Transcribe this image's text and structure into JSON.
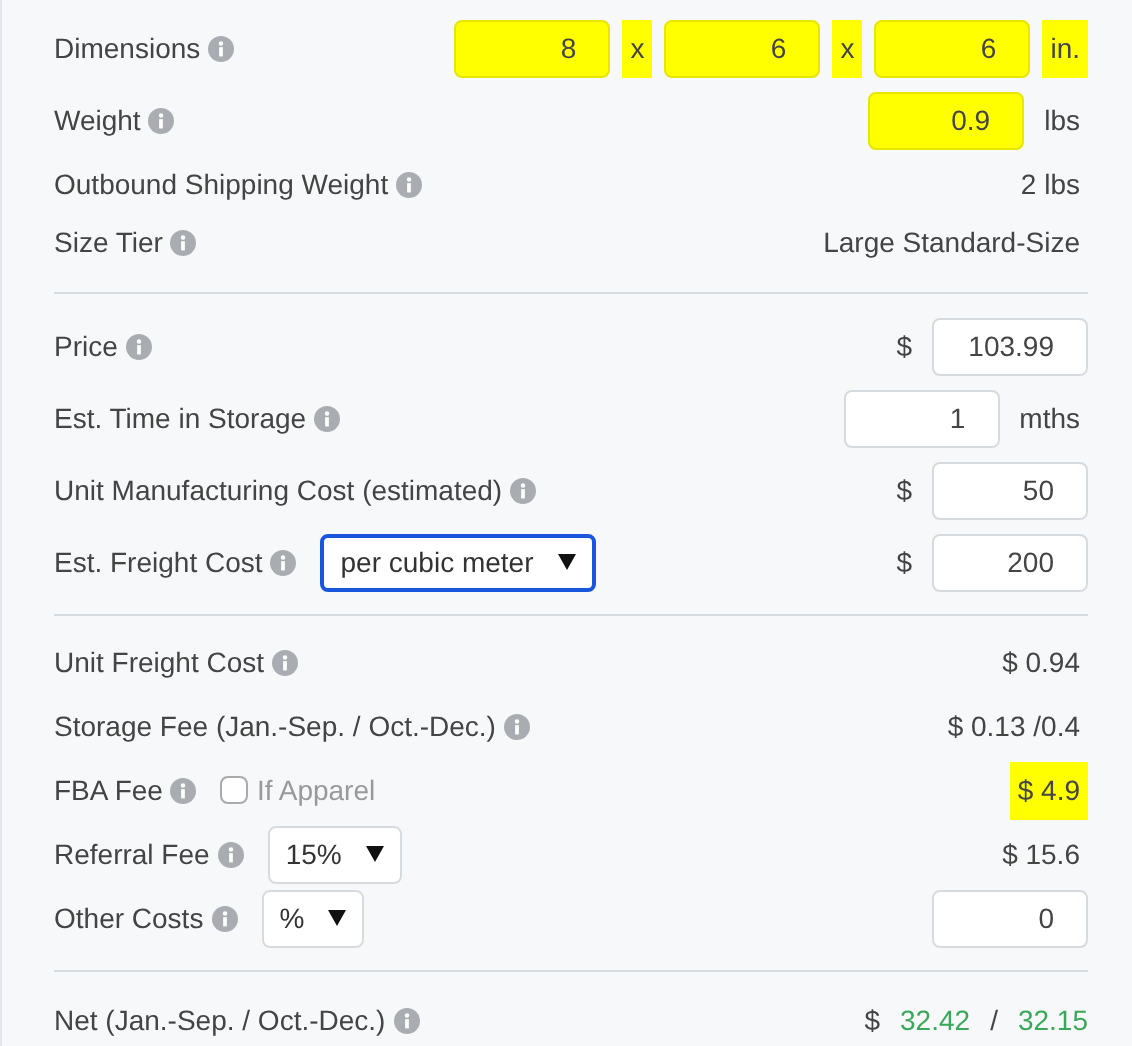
{
  "sections": [
    {
      "rows": [
        {
          "label": "Dimensions",
          "left": [],
          "right": [
            {
              "kind": "input",
              "value": "8",
              "highlighted": true
            },
            {
              "kind": "unit",
              "text": "x",
              "highlighted": true
            },
            {
              "kind": "input",
              "value": "6",
              "highlighted": true
            },
            {
              "kind": "unit",
              "text": "x",
              "highlighted": true
            },
            {
              "kind": "input",
              "value": "6",
              "highlighted": true
            },
            {
              "kind": "unit",
              "text": "in.",
              "highlighted": true
            }
          ]
        },
        {
          "label": "Weight",
          "left": [],
          "right": [
            {
              "kind": "input",
              "value": "0.9",
              "highlighted": true
            },
            {
              "kind": "unit",
              "text": "lbs",
              "highlighted": false
            }
          ]
        },
        {
          "label": "Outbound Shipping Weight",
          "left": [],
          "right": [
            {
              "kind": "unit",
              "text": "2 lbs",
              "highlighted": false
            }
          ]
        },
        {
          "label": "Size Tier",
          "left": [],
          "right": [
            {
              "kind": "unit",
              "text": "Large Standard-Size",
              "highlighted": false
            }
          ]
        }
      ]
    },
    {
      "rows": [
        {
          "label": "Price",
          "left": [],
          "right": [
            {
              "kind": "unit",
              "text": "$",
              "highlighted": false
            },
            {
              "kind": "input",
              "value": "103.99",
              "highlighted": false
            }
          ]
        },
        {
          "label": "Est. Time in Storage",
          "left": [],
          "right": [
            {
              "kind": "input",
              "value": "1",
              "highlighted": false
            },
            {
              "kind": "unit",
              "text": "mths",
              "highlighted": false
            }
          ]
        },
        {
          "label": "Unit Manufacturing Cost (estimated)",
          "left": [],
          "right": [
            {
              "kind": "unit",
              "text": "$",
              "highlighted": false
            },
            {
              "kind": "input",
              "value": "50",
              "highlighted": false
            }
          ]
        },
        {
          "label": "Est. Freight Cost",
          "left": [
            {
              "kind": "select",
              "value": "per cubic meter",
              "focused": true
            }
          ],
          "right": [
            {
              "kind": "unit",
              "text": "$",
              "highlighted": false
            },
            {
              "kind": "input",
              "value": "200",
              "highlighted": false
            }
          ]
        }
      ]
    },
    {
      "rows": [
        {
          "label": "Unit Freight Cost",
          "left": [],
          "right": [
            {
              "kind": "unit",
              "text": "$ 0.94",
              "highlighted": false
            }
          ]
        },
        {
          "label": "Storage Fee (Jan.-Sep. / Oct.-Dec.)",
          "left": [],
          "right": [
            {
              "kind": "unit",
              "text": "$ 0.13 /0.4",
              "highlighted": false
            }
          ]
        },
        {
          "label": "FBA Fee",
          "left": [
            {
              "kind": "checkbox",
              "text": "If Apparel",
              "checked": false
            }
          ],
          "right": [
            {
              "kind": "unit",
              "text": "$ 4.9",
              "highlighted": true
            }
          ]
        },
        {
          "label": "Referral Fee",
          "left": [
            {
              "kind": "select",
              "value": "15%",
              "focused": false
            }
          ],
          "right": [
            {
              "kind": "unit",
              "text": "$ 15.6",
              "highlighted": false
            }
          ]
        },
        {
          "label": "Other Costs",
          "left": [
            {
              "kind": "select",
              "value": "%",
              "focused": false
            }
          ],
          "right": [
            {
              "kind": "input",
              "value": "0",
              "highlighted": false
            }
          ]
        }
      ]
    },
    {
      "rows": [
        {
          "label": "Net (Jan.-Sep. / Oct.-Dec.)",
          "left": [],
          "right": [
            {
              "kind": "unit",
              "text": "$",
              "highlighted": false
            },
            {
              "kind": "amount",
              "text": "32.42",
              "positive": true
            },
            {
              "kind": "unit",
              "text": "/",
              "highlighted": false
            },
            {
              "kind": "amount",
              "text": "32.15",
              "positive": true
            }
          ]
        }
      ]
    }
  ]
}
